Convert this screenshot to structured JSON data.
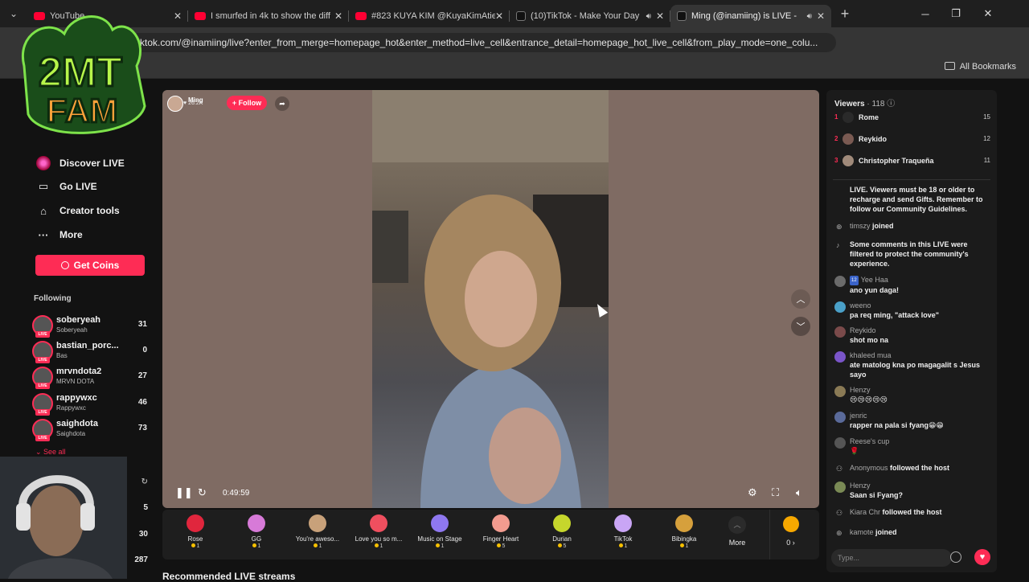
{
  "browser": {
    "tabs": [
      {
        "title": "YouTube",
        "fav": "yt",
        "active": false
      },
      {
        "title": "I smurfed in 4k to show the diff",
        "fav": "yt",
        "active": false
      },
      {
        "title": "#823 KUYA KIM @KuyaKimAtie",
        "fav": "yt",
        "active": false
      },
      {
        "title": "(10)TikTok - Make Your Day",
        "fav": "tt",
        "active": false,
        "audio": true
      },
      {
        "title": "Ming (@inamiing) is LIVE -",
        "fav": "tt",
        "active": true,
        "audio": true
      }
    ],
    "url": "tiktok.com/@inamiing/live?enter_from_merge=homepage_hot&enter_method=live_cell&entrance_detail=homepage_hot_live_cell&from_play_mode=one_colu...",
    "bookmarks_label": "All Bookmarks"
  },
  "logo": {
    "line1": "2MT",
    "line2": "FAM"
  },
  "sidebar": {
    "nav": [
      {
        "label": "Discover LIVE",
        "icon": "discover-live-icon"
      },
      {
        "label": "Go LIVE",
        "icon": "camera-icon"
      },
      {
        "label": "Creator tools",
        "icon": "home-icon"
      },
      {
        "label": "More",
        "icon": "more-dots-icon"
      }
    ],
    "get_coins": "Get Coins",
    "following_title": "Following",
    "following": [
      {
        "name": "soberyeah",
        "sub": "Soberyeah",
        "count": "31"
      },
      {
        "name": "bastian_porc...",
        "sub": "Bas",
        "count": "0"
      },
      {
        "name": "mrvndota2",
        "sub": "MRVN DOTA",
        "count": "27"
      },
      {
        "name": "rappywxc",
        "sub": "Rappywxc",
        "count": "46"
      },
      {
        "name": "saighdota",
        "sub": "Saighdota",
        "count": "73"
      }
    ],
    "see_all": "See all",
    "extra_counts": [
      "5",
      "30",
      "287"
    ],
    "live_badge": "LIVE"
  },
  "player": {
    "host_name": "Ming",
    "host_likes": "26.2K",
    "follow_label": "+ Follow",
    "time": "0:49:59"
  },
  "gifts": [
    {
      "name": "Rose",
      "price": "1",
      "color": "#e0263d"
    },
    {
      "name": "GG",
      "price": "1",
      "color": "#d77ad8"
    },
    {
      "name": "You're aweso...",
      "price": "1",
      "color": "#c8a17a"
    },
    {
      "name": "Love you so m...",
      "price": "1",
      "color": "#ef4f5f"
    },
    {
      "name": "Music on Stage",
      "price": "1",
      "color": "#8f78f0"
    },
    {
      "name": "Finger Heart",
      "price": "5",
      "color": "#f29b8f"
    },
    {
      "name": "Durian",
      "price": "5",
      "color": "#c6d62c"
    },
    {
      "name": "TikTok",
      "price": "1",
      "color": "#c9a5f5"
    },
    {
      "name": "Bibingka",
      "price": "1",
      "color": "#d6a03c"
    }
  ],
  "gift_more": "More",
  "coin_balance": "0 ›",
  "recommended_title": "Recommended LIVE streams",
  "chat": {
    "viewers_label": "Viewers",
    "viewers_count": "· 118",
    "ranking": [
      {
        "rank": "1",
        "name": "Rome",
        "score": "15"
      },
      {
        "rank": "2",
        "name": "Reykido",
        "score": "12"
      },
      {
        "rank": "3",
        "name": "Christopher Traqueña",
        "score": "11"
      }
    ],
    "messages": [
      {
        "type": "system",
        "text": "LIVE. Viewers must be 18 or older to recharge and send Gifts. Remember to follow our Community Guidelines."
      },
      {
        "type": "join",
        "user": "timszy",
        "text": "joined"
      },
      {
        "type": "system",
        "text": "Some comments in this LIVE were filtered to protect the community's experience."
      },
      {
        "type": "comment",
        "user": "Yee Haa",
        "level": "12",
        "text": "ano yun daga!"
      },
      {
        "type": "comment",
        "user": "weeno",
        "text": "pa req ming, \"attack love\""
      },
      {
        "type": "comment",
        "user": "Reykido",
        "text": "shot mo na"
      },
      {
        "type": "comment",
        "user": "khaleed mua",
        "text": "ate matolog kna po magagalit s Jesus sayo"
      },
      {
        "type": "comment",
        "user": "Henzy",
        "text": "😢😢😢😢😢"
      },
      {
        "type": "comment",
        "user": "jenric",
        "text": "rapper na pala si fyang😁😁"
      },
      {
        "type": "comment",
        "user": "Reese's cup",
        "text": "🌹"
      },
      {
        "type": "follow",
        "user": "Anonymous",
        "text": "followed the host"
      },
      {
        "type": "comment",
        "user": "Henzy",
        "text": "Saan si Fyang?"
      },
      {
        "type": "follow",
        "user": "Kiara Chr",
        "text": "followed the host"
      },
      {
        "type": "join",
        "user": "kamote",
        "text": "joined"
      }
    ],
    "input_placeholder": "Type..."
  }
}
